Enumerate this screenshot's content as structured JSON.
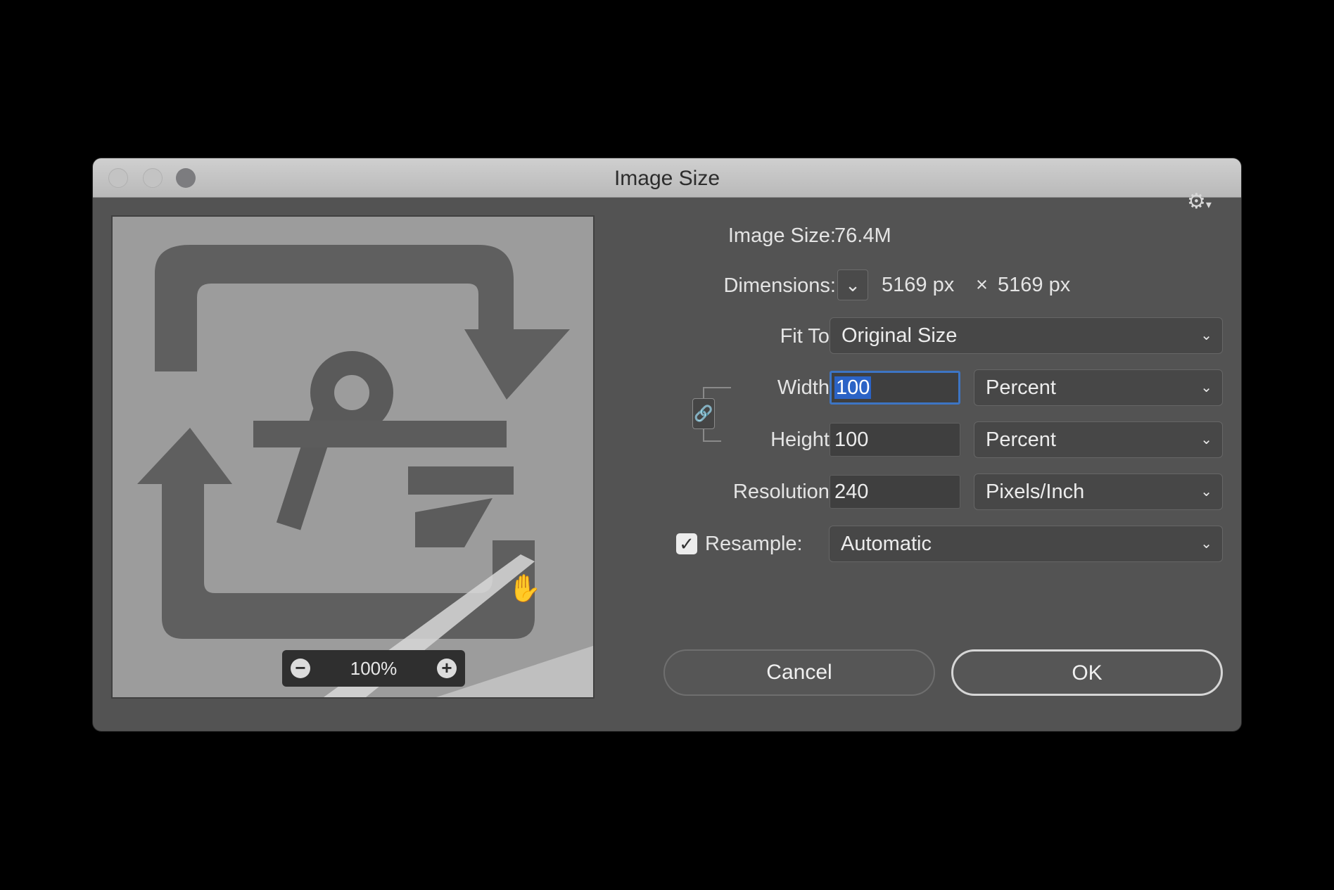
{
  "window": {
    "title": "Image Size"
  },
  "preview": {
    "zoom_level": "100%",
    "zoom_out": "−",
    "zoom_in": "+"
  },
  "info": {
    "image_size_label": "Image Size:",
    "image_size_value": "76.4M",
    "dimensions_label": "Dimensions:",
    "dim_width": "5169 px",
    "dim_times": "×",
    "dim_height": "5169 px"
  },
  "fit_to": {
    "label": "Fit To:",
    "value": "Original Size"
  },
  "width": {
    "label": "Width:",
    "value": "100",
    "unit": "Percent"
  },
  "height": {
    "label": "Height:",
    "value": "100",
    "unit": "Percent"
  },
  "resolution": {
    "label": "Resolution:",
    "value": "240",
    "unit": "Pixels/Inch"
  },
  "resample": {
    "label": "Resample:",
    "checked": true,
    "value": "Automatic"
  },
  "buttons": {
    "cancel": "Cancel",
    "ok": "OK"
  },
  "icons": {
    "gear": "gear-icon",
    "link": "constrain-link-icon",
    "chevron": "chevron-down-icon"
  }
}
